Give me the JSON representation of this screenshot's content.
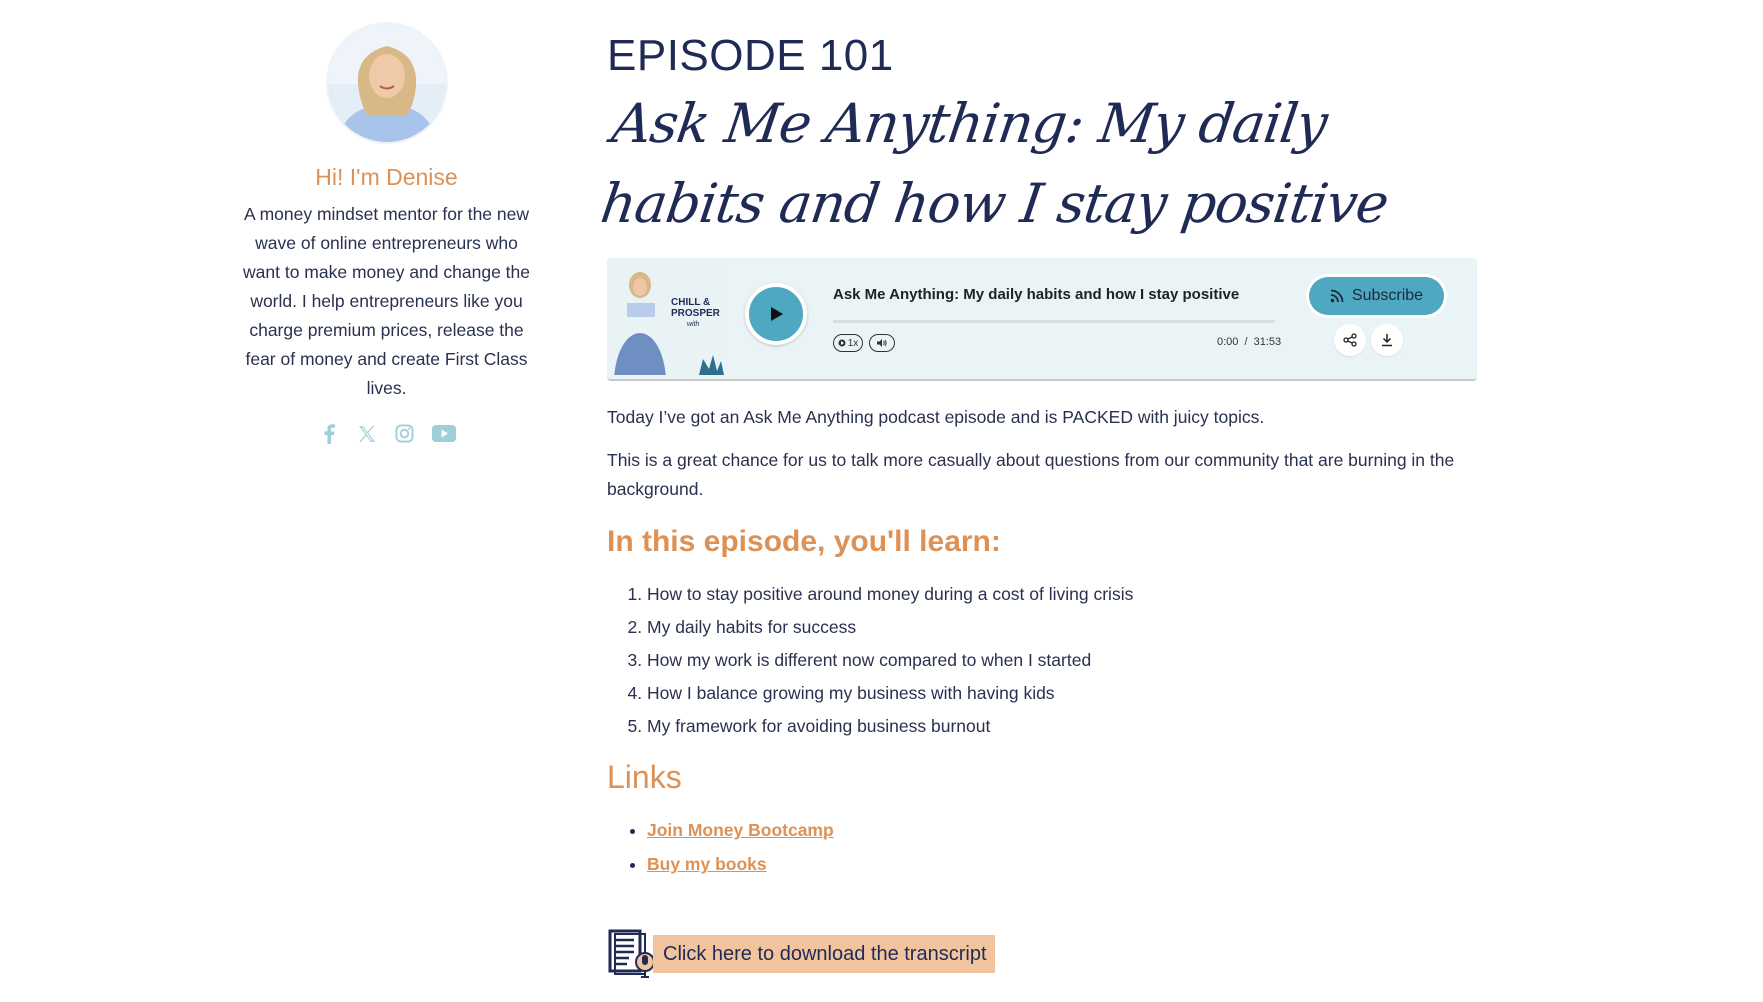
{
  "sidebar": {
    "greeting": "Hi! I'm Denise",
    "bio": "A money mindset mentor for the new wave of online entrepreneurs who want to make money and change the world. I help entrepreneurs like you charge premium prices, release the fear of money and create First Class lives.",
    "socials": [
      "facebook-icon",
      "x-icon",
      "instagram-icon",
      "youtube-icon"
    ]
  },
  "episode": {
    "number": "EPISODE 101",
    "title": "Ask Me Anything: My daily habits and how I stay positive"
  },
  "player": {
    "cover_title": "CHILL & PROSPER",
    "cover_with": "with",
    "track_title": "Ask Me Anything: My daily habits and how I stay positive",
    "speed": "1x",
    "time_current": "0:00",
    "time_separator": "/",
    "time_total": "31:53",
    "progress": 0,
    "subscribe_label": "Subscribe"
  },
  "content": {
    "intro_1": "Today I’ve got an Ask Me Anything podcast episode and is PACKED with juicy topics.",
    "intro_2": "This is a great chance for us to talk more casually about questions from our community that are burning in the background.",
    "learn_heading": "In this episode, you'll learn:",
    "learn_items": [
      "How to stay positive around money during a cost of living crisis",
      "My daily habits for success",
      "How my work is different now compared to when I started",
      "How I balance growing my business with having kids",
      "My framework for avoiding business burnout"
    ],
    "links_heading": "Links",
    "links": [
      "Join Money Bootcamp",
      "Buy my books"
    ]
  },
  "download": {
    "label": "Click here to download the transcript"
  },
  "colors": {
    "accent": "#de9154",
    "navy": "#1f2a55",
    "teal": "#4fa8c2",
    "player_bg": "#eaf4f7"
  }
}
